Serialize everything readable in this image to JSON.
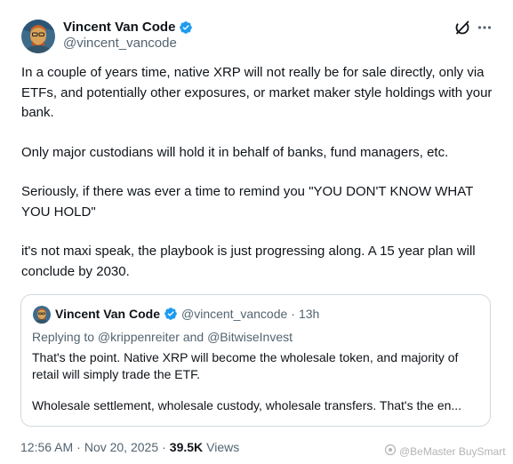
{
  "author": {
    "name": "Vincent Van Code",
    "handle": "@vincent_vancode"
  },
  "icons": {
    "verified": "verified-badge-icon",
    "grok": "grok-icon",
    "more": "more-icon",
    "verified_color": "#1d9bf0"
  },
  "post": {
    "paragraphs": [
      "In a couple of years time, native XRP will not really be for sale directly, only via ETFs, and potentially other exposures, or market maker style holdings with your bank.",
      "Only major custodians will hold it in behalf of banks, fund managers, etc.",
      "Seriously, if there was ever a time to remind you \"YOU DON'T KNOW WHAT YOU HOLD\"",
      "it's not maxi speak, the playbook is just progressing along.  A 15 year plan will conclude by 2030."
    ]
  },
  "quote": {
    "name": "Vincent Van Code",
    "handle": "@vincent_vancode",
    "separator": "·",
    "time": "13h",
    "replying_to": "Replying to @krippenreiter and @BitwiseInvest",
    "paragraphs": [
      "That's the point.  Native XRP will become the wholesale token, and majority of retail will simply trade the ETF.",
      "Wholesale settlement, wholesale custody, wholesale transfers.  That's the en..."
    ]
  },
  "footer": {
    "time": "12:56 AM",
    "separator1": "·",
    "date": "Nov 20, 2025",
    "separator2": "·",
    "views_count": "39.5K",
    "views_label": "Views"
  },
  "watermark": {
    "text": "@BeMaster BuySmart"
  }
}
